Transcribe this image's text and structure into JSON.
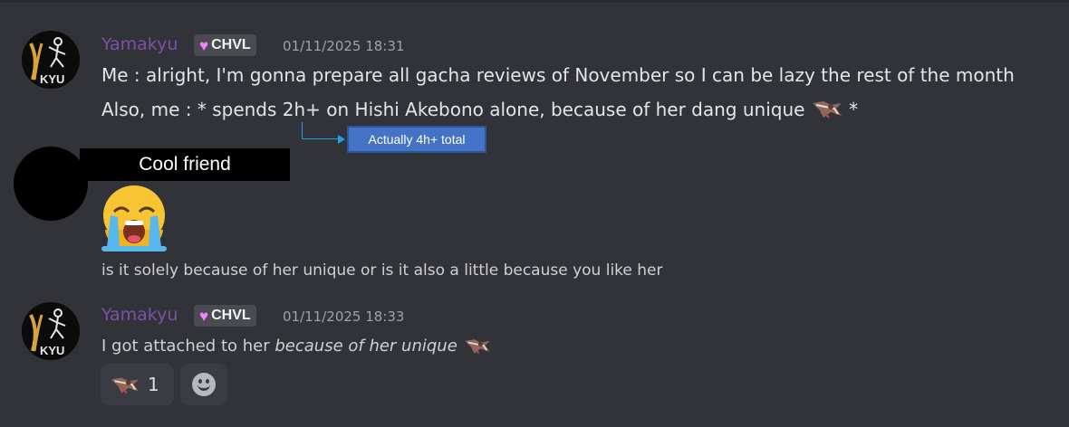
{
  "messages": [
    {
      "username": "Yamakyu",
      "tag": "CHVL",
      "timestamp": "01/11/2025 18:31",
      "line1": "Me : alright, I'm gonna prepare all gacha reviews of November so I can be lazy the rest of the month",
      "line2_before": "Also, me : * spends 2h+ on Hishi Akebono alone, because of her dang unique",
      "line2_after": "*"
    },
    {
      "content": "is it solely because of her unique or is it also a little because you like her"
    },
    {
      "username": "Yamakyu",
      "tag": "CHVL",
      "timestamp": "01/11/2025 18:33",
      "text_before": "I got attached to her ",
      "text_italic": "because of her unique"
    }
  ],
  "annotations": {
    "callout": "Actually 4h+ total",
    "redacted_name": "Cool friend"
  },
  "reactions": {
    "count": "1"
  },
  "icons": {
    "big_emoji": "loudly-crying-face-icon",
    "custom_emote": "hishi-akebono-emote-icon",
    "add_reaction": "smiley-add-reaction-icon",
    "avatar": "yamakyu-avatar-icon"
  },
  "colors": {
    "background": "#323339",
    "username": "#7e4fa8",
    "tag_bg": "#4a4b51",
    "callout_bg": "#4472c4",
    "callout_line": "#1fa0e0"
  }
}
